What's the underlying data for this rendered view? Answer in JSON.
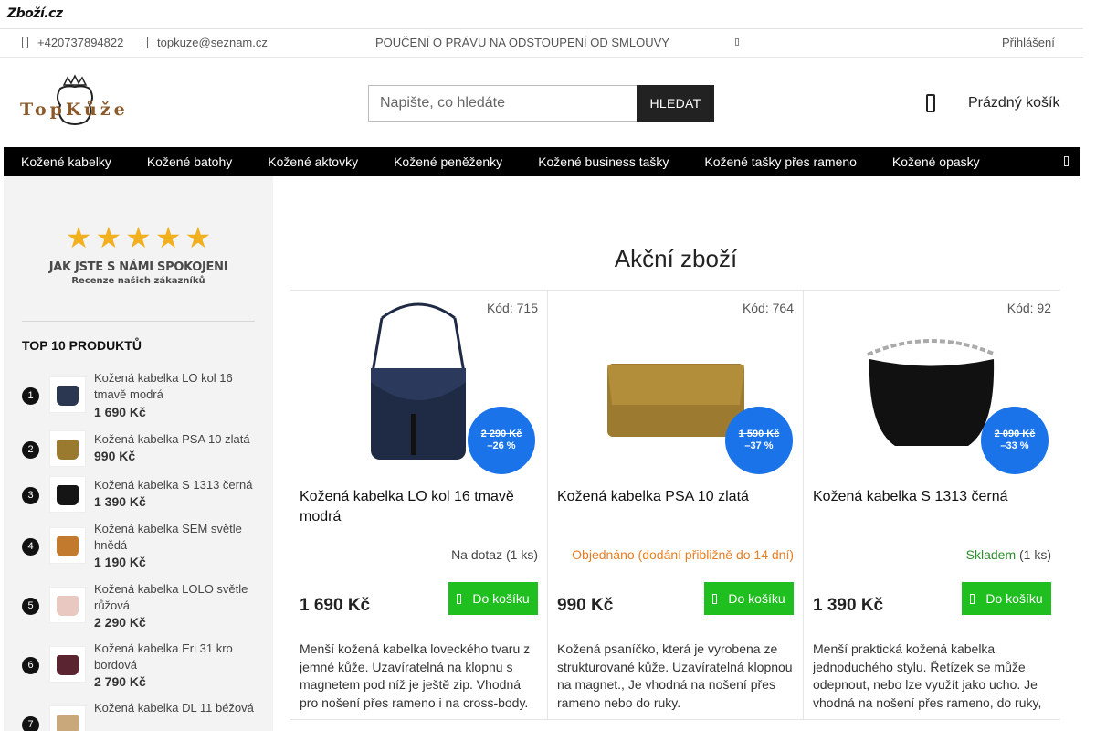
{
  "zbozi": {
    "brand": "Zboží.cz"
  },
  "infobar": {
    "phone": "+420737894822",
    "email": "topkuze@seznam.cz",
    "notice": "POUČENÍ O PRÁVU NA ODSTOUPENÍ OD SMLOUVY",
    "login": "Přihlášení"
  },
  "header": {
    "logo_text": "TopKůže",
    "search_placeholder": "Napište, co hledáte",
    "search_button": "HLEDAT",
    "cart_label": "Prázdný košík"
  },
  "nav": {
    "items": [
      "Kožené kabelky",
      "Kožené batohy",
      "Kožené aktovky",
      "Kožené peněženky",
      "Kožené business tašky",
      "Kožené tašky přes rameno",
      "Kožené opasky"
    ]
  },
  "sidebar": {
    "rating_title": "JAK JSTE S NÁMI SPOKOJENI",
    "rating_subtitle": "Recenze našich zákazníků",
    "top_title": "TOP 10 PRODUKTŮ",
    "items": [
      {
        "num": "1",
        "name": "Kožená kabelka LO kol 16 tmavě modrá",
        "price": "1 690 Kč",
        "color": "#2b3650"
      },
      {
        "num": "2",
        "name": "Kožená kabelka PSA 10 zlatá",
        "price": "990 Kč",
        "color": "#9a7a2e"
      },
      {
        "num": "3",
        "name": "Kožená kabelka S 1313 černá",
        "price": "1 390 Kč",
        "color": "#151515"
      },
      {
        "num": "4",
        "name": "Kožená kabelka SEM světle hnědá",
        "price": "1 190 Kč",
        "color": "#c27a2f"
      },
      {
        "num": "5",
        "name": "Kožená kabelka LOLO světle růžová",
        "price": "2 290 Kč",
        "color": "#e8c8c0"
      },
      {
        "num": "6",
        "name": "Kožená kabelka Eri 31 kro bordová",
        "price": "2 790 Kč",
        "color": "#5a2430"
      },
      {
        "num": "7",
        "name": "Kožená kabelka DL 11 béžová",
        "price": "",
        "color": "#c9a97c"
      }
    ]
  },
  "main": {
    "title": "Akční zboží",
    "products": [
      {
        "code": "Kód: 715",
        "name": "Kožená kabelka LO kol 16 tmavě modrá",
        "old_price": "2 290 Kč",
        "discount": "–26 %",
        "stock": "Na dotaz",
        "stock_qty": "(1 ks)",
        "price": "1 690 Kč",
        "button": "Do košíku",
        "desc": "Menší kožená kabelka loveckého tvaru z jemné kůže. Uzavíratelná na klopnu s magnetem pod níž je ještě zip. Vhodná pro nošení přes rameno i na cross-body.",
        "color": "#1f2a44"
      },
      {
        "code": "Kód: 764",
        "name": "Kožená kabelka PSA 10 zlatá",
        "old_price": "1 590 Kč",
        "discount": "–37 %",
        "stock": "Objednáno (dodání přibližně do 14 dní)",
        "stock_qty": "",
        "price": "990 Kč",
        "button": "Do košíku",
        "desc": "Kožená psaníčko, která je vyrobena ze strukturované kůže. Uzavíratelná klopnou na magnet., Je vhodná na nošení přes rameno nebo do ruky.",
        "color": "#9c7a30"
      },
      {
        "code": "Kód: 92",
        "name": "Kožená kabelka S 1313 černá",
        "old_price": "2 090 Kč",
        "discount": "–33 %",
        "stock": "Skladem",
        "stock_qty": "(1 ks)",
        "price": "1 390 Kč",
        "button": "Do košíku",
        "desc": "Menší praktická kožená kabelka jednoduchého stylu. Řetízek se může odepnout, nebo lze využít jako ucho. Je vhodná na nošení přes rameno, do ruky,",
        "color": "#111111"
      }
    ]
  }
}
